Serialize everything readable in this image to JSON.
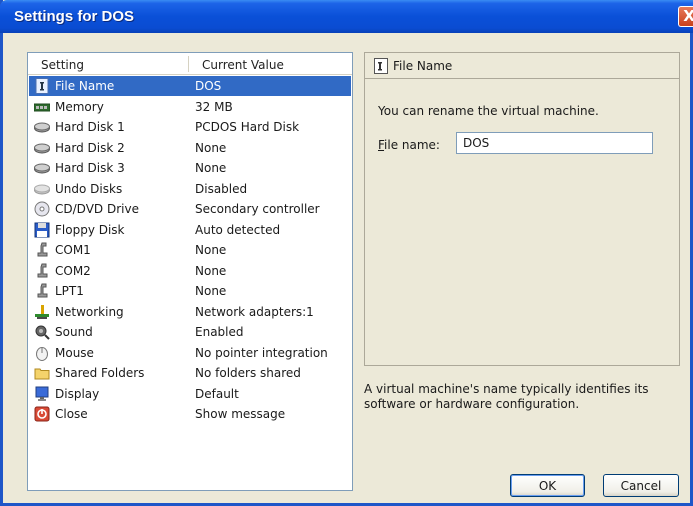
{
  "window": {
    "title": "Settings for DOS",
    "close_label": "X"
  },
  "list": {
    "headers": {
      "setting": "Setting",
      "value": "Current Value"
    },
    "items": [
      {
        "name": "File Name",
        "value": "DOS",
        "icon": "file-name-icon",
        "selected": true
      },
      {
        "name": "Memory",
        "value": "32 MB",
        "icon": "memory-icon"
      },
      {
        "name": "Hard Disk 1",
        "value": "PCDOS Hard Disk",
        "icon": "hard-disk-icon"
      },
      {
        "name": "Hard Disk 2",
        "value": "None",
        "icon": "hard-disk-icon"
      },
      {
        "name": "Hard Disk 3",
        "value": "None",
        "icon": "hard-disk-icon"
      },
      {
        "name": "Undo Disks",
        "value": "Disabled",
        "icon": "undo-disks-icon"
      },
      {
        "name": "CD/DVD Drive",
        "value": "Secondary controller",
        "icon": "cd-dvd-icon"
      },
      {
        "name": "Floppy Disk",
        "value": "Auto detected",
        "icon": "floppy-disk-icon"
      },
      {
        "name": "COM1",
        "value": "None",
        "icon": "com-port-icon"
      },
      {
        "name": "COM2",
        "value": "None",
        "icon": "com-port-icon"
      },
      {
        "name": "LPT1",
        "value": "None",
        "icon": "lpt-port-icon"
      },
      {
        "name": "Networking",
        "value": "Network adapters:1",
        "icon": "networking-icon"
      },
      {
        "name": "Sound",
        "value": "Enabled",
        "icon": "sound-icon"
      },
      {
        "name": "Mouse",
        "value": "No pointer integration",
        "icon": "mouse-icon"
      },
      {
        "name": "Shared Folders",
        "value": "No folders shared",
        "icon": "shared-folders-icon"
      },
      {
        "name": "Display",
        "value": "Default",
        "icon": "display-icon"
      },
      {
        "name": "Close",
        "value": "Show message",
        "icon": "close-setting-icon"
      }
    ]
  },
  "detail": {
    "heading": "File Name",
    "message": "You can rename the virtual machine.",
    "file_label_accel": "F",
    "file_label_rest": "ile name:",
    "file_value": "DOS"
  },
  "hint": "A virtual machine's name typically identifies its software or hardware configuration.",
  "buttons": {
    "ok": "OK",
    "cancel": "Cancel"
  },
  "colors": {
    "titlebar": "#0a50d8",
    "selection": "#316ac5",
    "dialog_bg": "#ece9d8"
  }
}
